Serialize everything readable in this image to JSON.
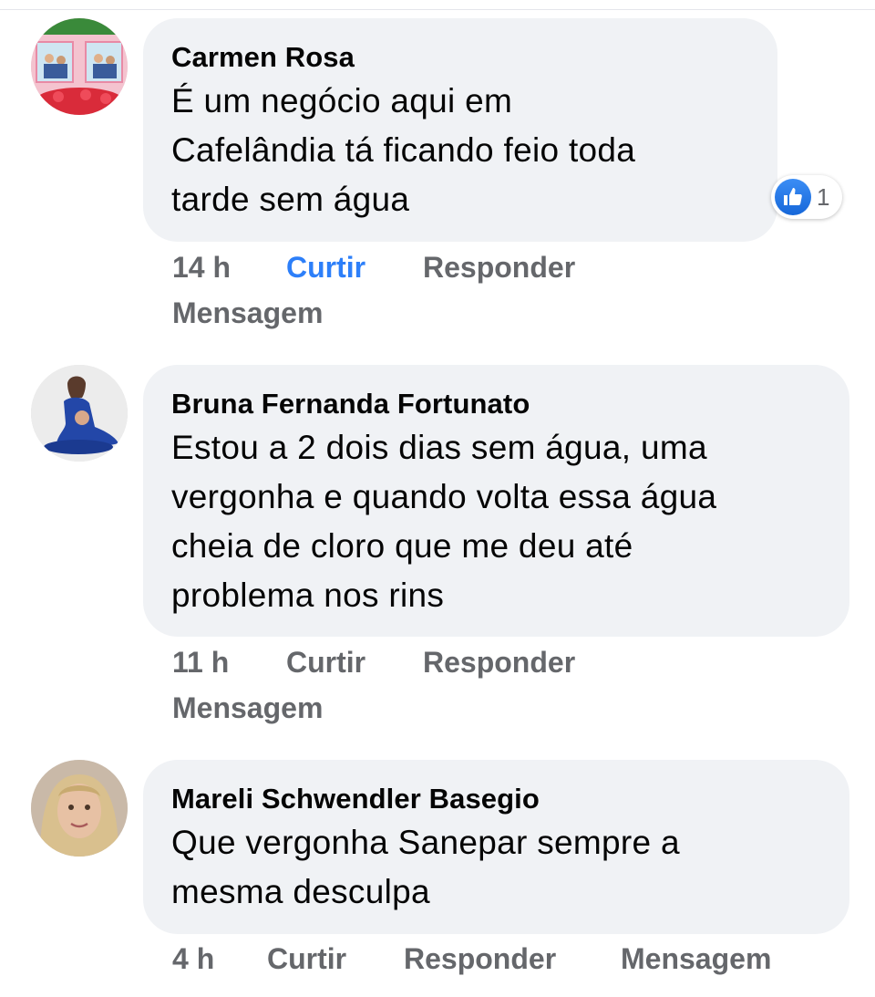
{
  "comments": [
    {
      "author": "Carmen Rosa",
      "text": "É um negócio aqui em\nCafelândia tá ficando feio toda\ntarde sem água",
      "time": "14 h",
      "like_label": "Curtir",
      "reply_label": "Responder",
      "message_label": "Mensagem",
      "liked": true,
      "reaction_count": "1",
      "like_color": "#2d7ff9"
    },
    {
      "author": "Bruna Fernanda Fortunato",
      "text": "Estou a 2 dois dias sem água, uma\nvergonha e quando volta essa água\ncheia de cloro que me deu até\nproblema nos rins",
      "time": "11 h",
      "like_label": "Curtir",
      "reply_label": "Responder",
      "message_label": "Mensagem",
      "liked": false
    },
    {
      "author": "Mareli Schwendler Basegio",
      "text": "Que vergonha Sanepar sempre a\nmesma desculpa",
      "time": "4 h",
      "like_label": "Curtir",
      "reply_label": "Responder",
      "message_label": "Mensagem",
      "liked": false
    }
  ],
  "colors": {
    "bubble_bg": "#f0f2f5",
    "action_gray": "#65676b",
    "accent_blue": "#2d7ff9"
  },
  "icons": {
    "reaction": "thumbs-up-icon"
  }
}
